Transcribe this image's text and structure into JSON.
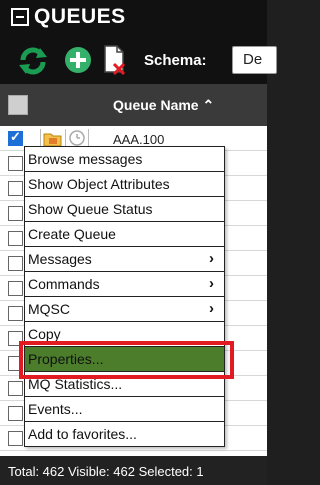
{
  "app": {
    "title": "QUEUES"
  },
  "toolbar": {
    "refresh_icon": "refresh-icon",
    "add_icon": "add-circle-icon",
    "delete_icon": "delete-document-icon",
    "schema_label": "Schema:",
    "schema_value": "De"
  },
  "table": {
    "header": "Queue Name ⌃",
    "rows": [
      {
        "name": "AAA.100",
        "checked": true
      },
      {
        "name": "",
        "checked": false
      },
      {
        "name": "",
        "checked": false
      },
      {
        "name": "",
        "checked": false
      },
      {
        "name": "",
        "checked": false
      },
      {
        "name": "",
        "checked": false
      },
      {
        "name": "",
        "checked": false
      },
      {
        "name": "",
        "checked": false
      },
      {
        "name": "",
        "checked": false
      },
      {
        "name": "",
        "checked": false
      },
      {
        "name": "",
        "checked": false
      },
      {
        "name": "",
        "checked": false
      },
      {
        "name": "",
        "checked": false
      }
    ]
  },
  "context_menu": {
    "items": [
      {
        "label": "Browse messages"
      },
      {
        "label": "Show Object Attributes"
      },
      {
        "label": "Show Queue Status"
      },
      {
        "label": "Create Queue"
      },
      {
        "label": "Messages",
        "submenu": true
      },
      {
        "label": "Commands",
        "submenu": true
      },
      {
        "label": "MQSC",
        "submenu": true
      },
      {
        "label": "Copy"
      },
      {
        "label": "Properties...",
        "highlighted": true
      },
      {
        "label": "MQ Statistics..."
      },
      {
        "label": "Events..."
      },
      {
        "label": "Add to favorites..."
      }
    ]
  },
  "status": {
    "text": "Total: 462 Visible: 462 Selected: 1"
  },
  "colors": {
    "highlight": "#4b7d2a",
    "annotation": "#e21b23",
    "refresh": "#1b9c53",
    "add": "#35b06a"
  }
}
